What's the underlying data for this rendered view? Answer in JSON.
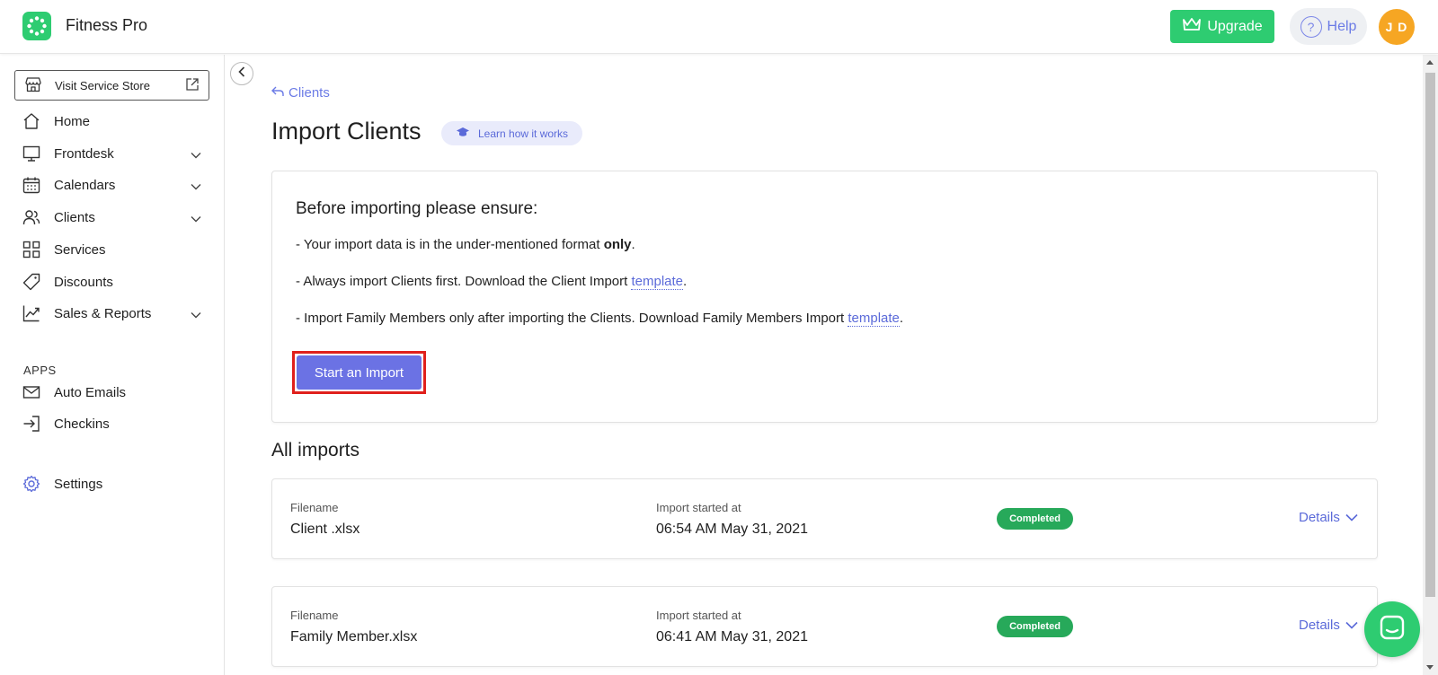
{
  "app": {
    "name": "Fitness Pro"
  },
  "header": {
    "upgrade_label": "Upgrade",
    "help_label": "Help",
    "avatar_initials": "J D"
  },
  "sidebar": {
    "store_label": "Visit Service Store",
    "items": [
      {
        "label": "Home",
        "icon": "home-icon",
        "has_chevron": false
      },
      {
        "label": "Frontdesk",
        "icon": "monitor-icon",
        "has_chevron": true
      },
      {
        "label": "Calendars",
        "icon": "calendar-icon",
        "has_chevron": true
      },
      {
        "label": "Clients",
        "icon": "users-icon",
        "has_chevron": true
      },
      {
        "label": "Services",
        "icon": "grid-icon",
        "has_chevron": false
      },
      {
        "label": "Discounts",
        "icon": "tag-icon",
        "has_chevron": false
      },
      {
        "label": "Sales & Reports",
        "icon": "chart-icon",
        "has_chevron": true
      }
    ],
    "apps_label": "APPS",
    "apps": [
      {
        "label": "Auto Emails",
        "icon": "mail-icon"
      },
      {
        "label": "Checkins",
        "icon": "login-icon"
      }
    ],
    "settings_label": "Settings"
  },
  "main": {
    "back_label": "Clients",
    "title": "Import Clients",
    "learn_label": "Learn how it works",
    "notice": {
      "heading": "Before importing please ensure:",
      "line1_prefix": "- Your import data is in the under-mentioned format ",
      "line1_bold": "only",
      "line1_suffix": ".",
      "line2_prefix": "- Always import Clients first. Download the Client Import ",
      "line2_link": "template",
      "line2_suffix": ".",
      "line3_prefix": "- Import Family Members only after importing the Clients. Download Family Members Import ",
      "line3_link": "template",
      "line3_suffix": "."
    },
    "start_button": "Start an Import",
    "imports_title": "All imports",
    "imports": [
      {
        "filename_label": "Filename",
        "filename": "Client .xlsx",
        "started_label": "Import started at",
        "started": "06:54 AM May 31, 2021",
        "status": "Completed",
        "details_label": "Details"
      },
      {
        "filename_label": "Filename",
        "filename": "Family Member.xlsx",
        "started_label": "Import started at",
        "started": "06:41 AM May 31, 2021",
        "status": "Completed",
        "details_label": "Details"
      }
    ]
  },
  "colors": {
    "brand_green": "#2ecc71",
    "accent": "#6b72e4",
    "status_green": "#27a95a",
    "highlight_red": "#e0201c"
  }
}
